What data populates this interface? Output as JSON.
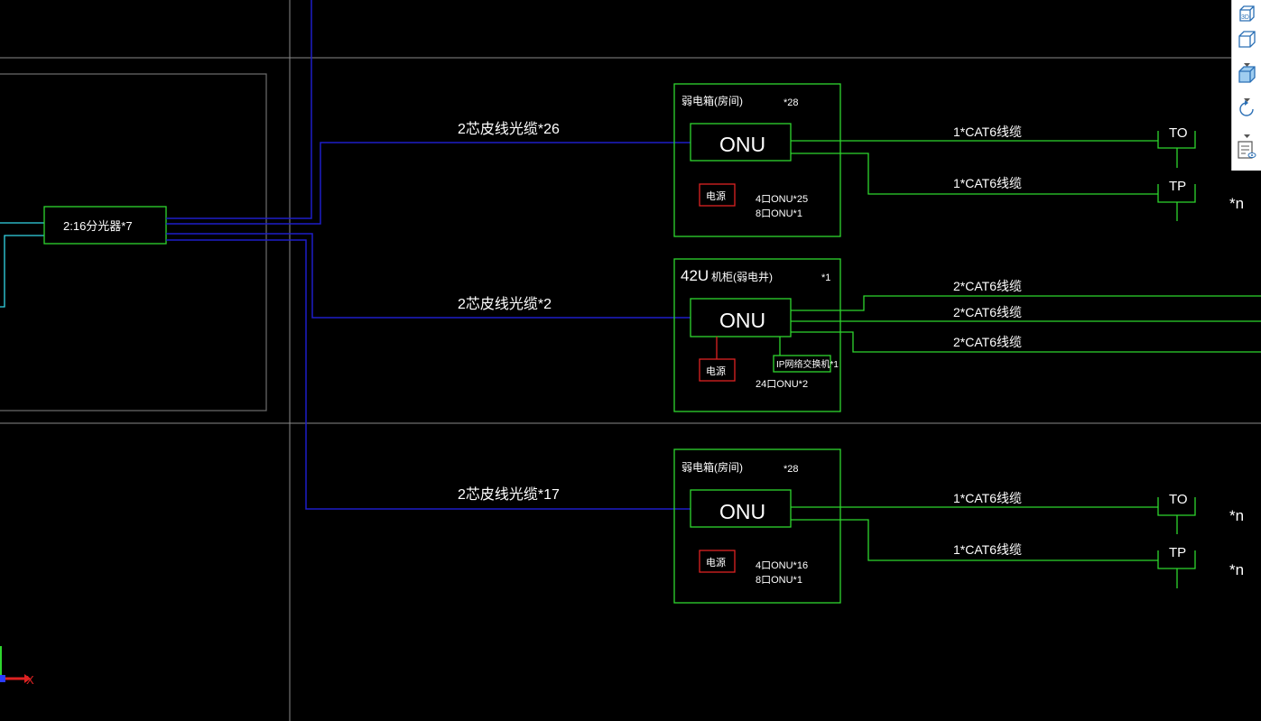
{
  "feeds": {
    "room1": "2芯皮线光缆*26",
    "shaft": "2芯皮线光缆*2",
    "room2": "2芯皮线光缆*17"
  },
  "splitter": {
    "label": "2:16分光器*7"
  },
  "cabinet_room_1": {
    "title": "弱电箱(房间)",
    "count": "*28",
    "onu_label": "ONU",
    "power_label": "电源",
    "note1": "4口ONU*25",
    "note2": "8口ONU*1",
    "line1": "1*CAT6线缆",
    "line2": "1*CAT6线缆",
    "to_label": "TO",
    "tp_label": "TP",
    "mult": "*n"
  },
  "cabinet_shaft": {
    "title_big": "42U",
    "title_rest": "机柜(弱电井)",
    "count": "*1",
    "onu_label": "ONU",
    "power_label": "电源",
    "switch_label": "IP网络交换机*1",
    "note1": "24口ONU*2",
    "line1": "2*CAT6线缆",
    "line2": "2*CAT6线缆",
    "line3": "2*CAT6线缆"
  },
  "cabinet_room_2": {
    "title": "弱电箱(房间)",
    "count": "*28",
    "onu_label": "ONU",
    "power_label": "电源",
    "note1": "4口ONU*16",
    "note2": "8口ONU*1",
    "line1": "1*CAT6线缆",
    "line2": "1*CAT6线缆",
    "to_label": "TO",
    "tp_label": "TP",
    "mult1": "*n",
    "mult2": "*n"
  },
  "ucs": {
    "x_label": "X"
  },
  "colors": {
    "background": "#000000",
    "fiber": "#1e1ec8",
    "green": "#2ed62e",
    "cyan": "#33d6e6",
    "red": "#dd2222",
    "grid": "#8a8a8a"
  },
  "view_toolbar": {
    "icons": [
      "3d-view-icon",
      "view-cube-icon",
      "shaded-cube-icon",
      "orbit-icon",
      "view-manager-icon"
    ]
  }
}
